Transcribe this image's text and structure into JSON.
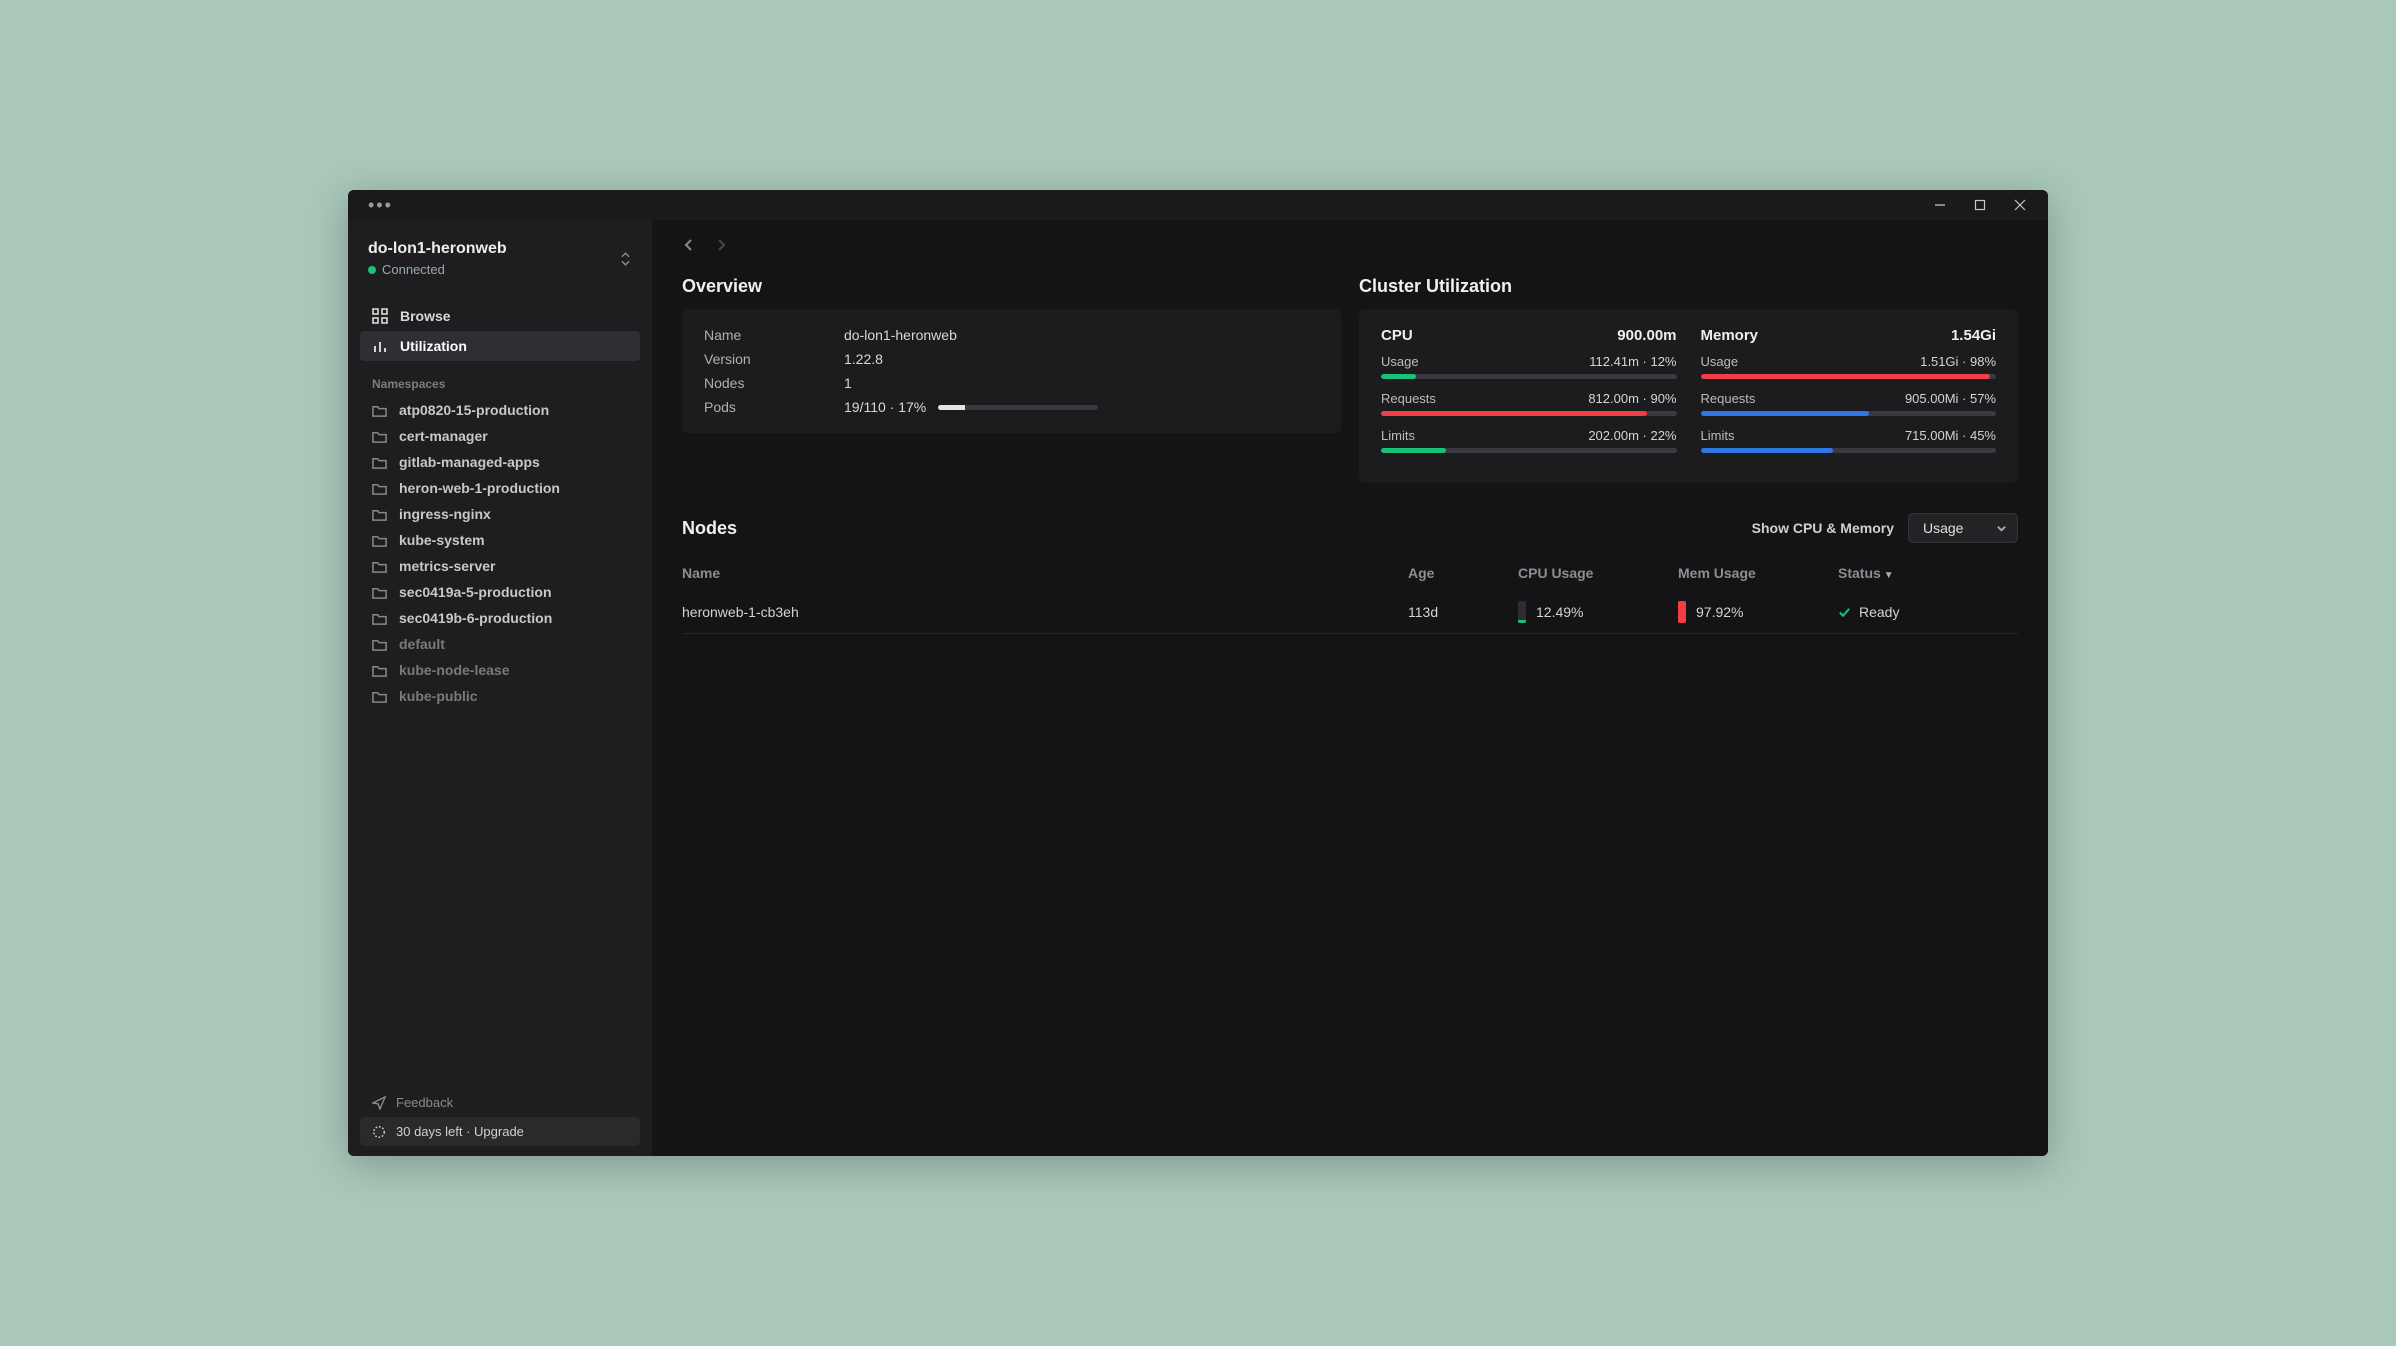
{
  "window": {
    "menu_label": "•••"
  },
  "sidebar": {
    "cluster_name": "do-lon1-heronweb",
    "status_label": "Connected",
    "nav": {
      "browse": "Browse",
      "utilization": "Utilization"
    },
    "namespaces_label": "Namespaces",
    "namespaces": [
      {
        "label": "atp0820-15-production",
        "dim": false
      },
      {
        "label": "cert-manager",
        "dim": false
      },
      {
        "label": "gitlab-managed-apps",
        "dim": false
      },
      {
        "label": "heron-web-1-production",
        "dim": false
      },
      {
        "label": "ingress-nginx",
        "dim": false
      },
      {
        "label": "kube-system",
        "dim": false
      },
      {
        "label": "metrics-server",
        "dim": false
      },
      {
        "label": "sec0419a-5-production",
        "dim": false
      },
      {
        "label": "sec0419b-6-production",
        "dim": false
      },
      {
        "label": "default",
        "dim": true
      },
      {
        "label": "kube-node-lease",
        "dim": true
      },
      {
        "label": "kube-public",
        "dim": true
      }
    ],
    "footer": {
      "feedback": "Feedback",
      "upgrade": "30 days left · Upgrade"
    }
  },
  "overview": {
    "title": "Overview",
    "rows": {
      "name_label": "Name",
      "name_value": "do-lon1-heronweb",
      "version_label": "Version",
      "version_value": "1.22.8",
      "nodes_label": "Nodes",
      "nodes_value": "1",
      "pods_label": "Pods",
      "pods_value": "19/110 · 17%",
      "pods_percent": 17
    }
  },
  "cluster_util": {
    "title": "Cluster Utilization",
    "cpu": {
      "header": "CPU",
      "total": "900.00m",
      "usage_label": "Usage",
      "usage_value": "112.41m · 12%",
      "usage_pct": 12,
      "usage_color": "green",
      "requests_label": "Requests",
      "requests_value": "812.00m · 90%",
      "requests_pct": 90,
      "requests_color": "red",
      "limits_label": "Limits",
      "limits_value": "202.00m · 22%",
      "limits_pct": 22,
      "limits_color": "green"
    },
    "memory": {
      "header": "Memory",
      "total": "1.54Gi",
      "usage_label": "Usage",
      "usage_value": "1.51Gi · 98%",
      "usage_pct": 98,
      "usage_color": "red",
      "requests_label": "Requests",
      "requests_value": "905.00Mi · 57%",
      "requests_pct": 57,
      "requests_color": "blue",
      "limits_label": "Limits",
      "limits_value": "715.00Mi · 45%",
      "limits_pct": 45,
      "limits_color": "blue"
    }
  },
  "nodes": {
    "title": "Nodes",
    "show_label": "Show CPU & Memory",
    "dropdown_value": "Usage",
    "columns": {
      "name": "Name",
      "age": "Age",
      "cpu": "CPU Usage",
      "mem": "Mem Usage",
      "status": "Status"
    },
    "rows": [
      {
        "name": "heronweb-1-cb3eh",
        "age": "113d",
        "cpu_pct": 12.49,
        "cpu_label": "12.49%",
        "cpu_color": "green",
        "mem_pct": 97.92,
        "mem_label": "97.92%",
        "mem_color": "red",
        "status": "Ready"
      }
    ]
  }
}
